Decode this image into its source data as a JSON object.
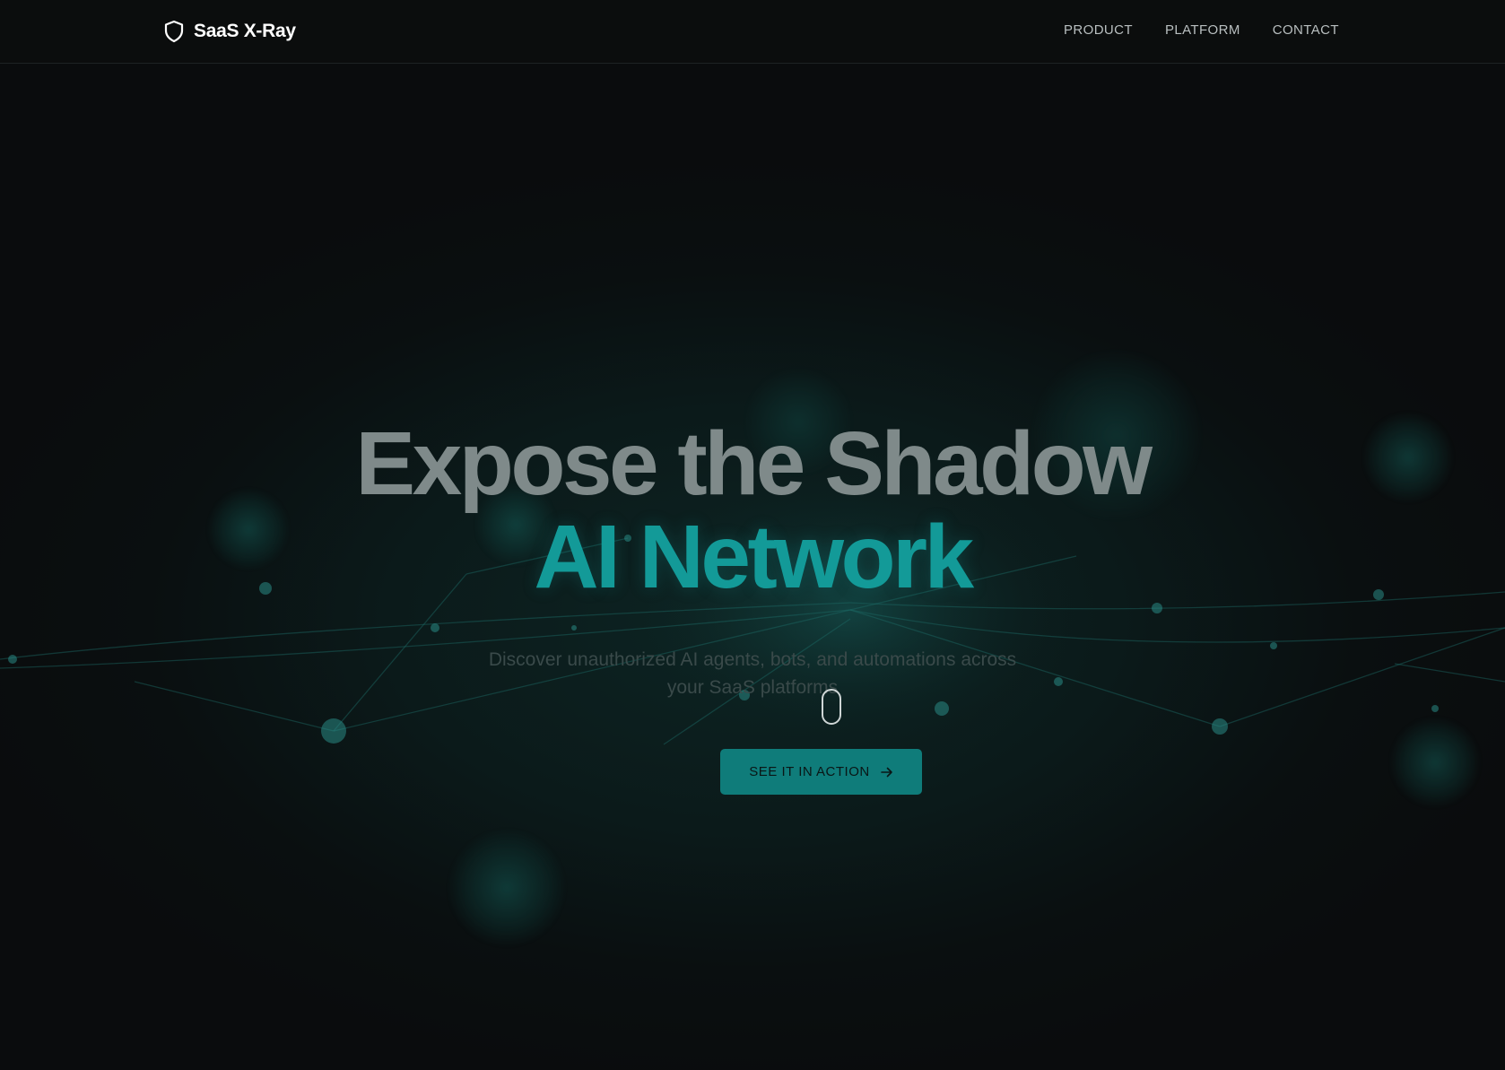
{
  "header": {
    "brand_name": "SaaS X-Ray",
    "brand_icon": "shield-icon",
    "nav": [
      {
        "label": "PRODUCT"
      },
      {
        "label": "PLATFORM"
      },
      {
        "label": "CONTACT"
      }
    ]
  },
  "hero": {
    "headline_line1": "Expose the Shadow",
    "headline_line2": "AI Network",
    "subtitle": "Discover unauthorized AI agents, bots, and automations across your SaaS platforms",
    "cta_label": "SEE IT IN ACTION",
    "cta_icon": "arrow-right-icon",
    "scroll_icon": "mouse-scroll-icon"
  },
  "colors": {
    "background": "#0a0d0e",
    "accent": "#139a98",
    "button": "#0f7c7a",
    "headline_primary": "#7f8a8a"
  }
}
